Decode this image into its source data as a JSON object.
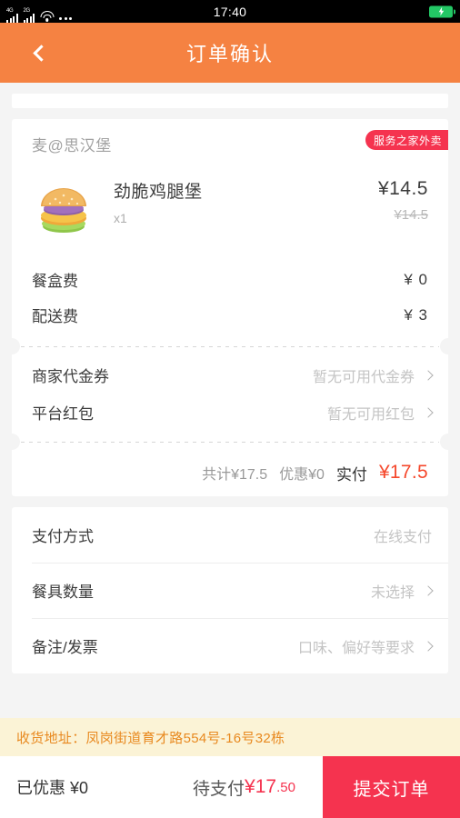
{
  "statusbar": {
    "signal_1_label": "4G",
    "signal_2_label": "2G",
    "time": "17:40",
    "wifi_icon": "wifi-icon",
    "more_icon": "more-dots-icon",
    "battery_icon": "battery-charging-icon"
  },
  "header": {
    "title": "订单确认",
    "back_icon": "chevron-left-icon"
  },
  "shop": {
    "name": "麦@思汉堡",
    "badge": "服务之家外卖"
  },
  "item": {
    "name": "劲脆鸡腿堡",
    "quantity": "x1",
    "price": "¥14.5",
    "original_price": "¥14.5",
    "thumb_icon": "burger-image"
  },
  "fees": [
    {
      "label": "餐盒费",
      "value": "¥ 0"
    },
    {
      "label": "配送费",
      "value": "¥ 3"
    }
  ],
  "coupons": [
    {
      "label": "商家代金券",
      "value": "暂无可用代金券",
      "chevron": "chevron-right-icon"
    },
    {
      "label": "平台红包",
      "value": "暂无可用红包",
      "chevron": "chevron-right-icon"
    }
  ],
  "totals": {
    "subtotal": "共计¥17.5",
    "discount": "优惠¥0",
    "actual_label": "实付",
    "actual_amount": "¥17.5"
  },
  "options": [
    {
      "label": "支付方式",
      "value": "在线支付",
      "has_chevron": false
    },
    {
      "label": "餐具数量",
      "value": "未选择",
      "has_chevron": true
    },
    {
      "label": "备注/发票",
      "value": "口味、偏好等要求",
      "has_chevron": true
    }
  ],
  "address": {
    "text": "收货地址：凤岗街道育才路554号-16号32栋"
  },
  "bottom": {
    "discount_label": "已优惠 ¥0",
    "pay_label": "待支付",
    "pay_amount": "¥17",
    "pay_cents": ".50",
    "submit_label": "提交订单"
  },
  "colors": {
    "header_orange": "#f58242",
    "brand_red": "#f5334f",
    "price_red": "#f5482c",
    "address_bg": "#fbf3d6",
    "address_text": "#e8891f",
    "page_bg": "#f4f4f4"
  }
}
